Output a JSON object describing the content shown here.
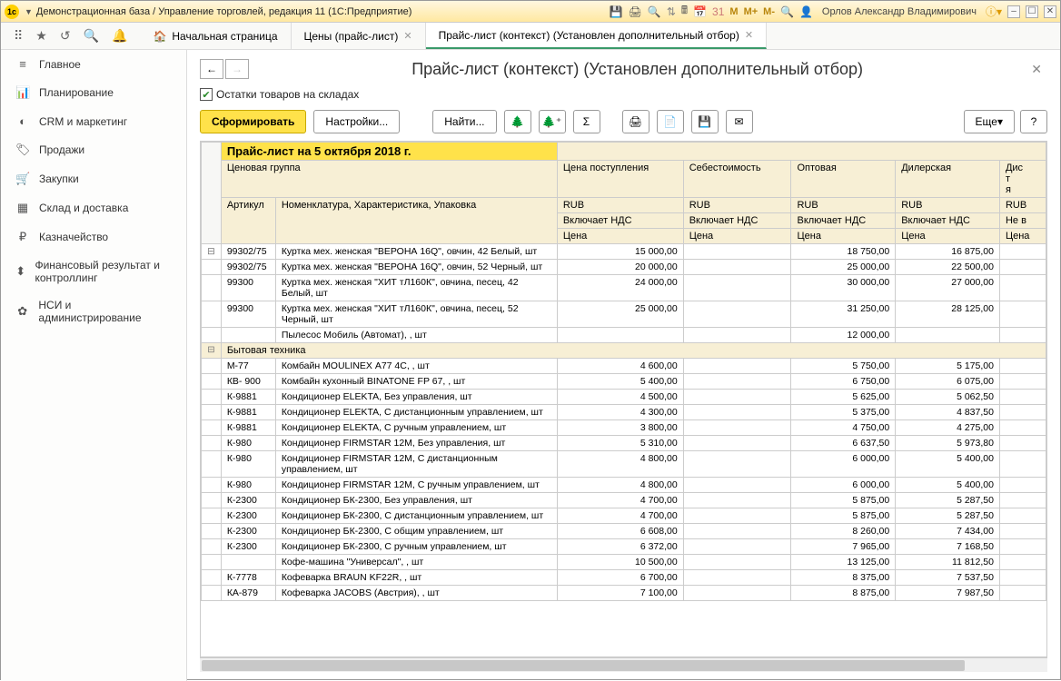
{
  "titlebar": {
    "title": "Демонстрационная база / Управление торговлей, редакция 11  (1С:Предприятие)",
    "user": "Орлов Александр Владимирович"
  },
  "navtabs": {
    "home": "Начальная страница",
    "prices": "Цены (прайс-лист)",
    "pricelist": "Прайс-лист (контекст) (Установлен дополнительный отбор)"
  },
  "sidebar": {
    "items": [
      {
        "icon": "≡",
        "label": "Главное"
      },
      {
        "icon": "📊",
        "label": "Планирование"
      },
      {
        "icon": "◐",
        "label": "CRM и маркетинг"
      },
      {
        "icon": "🏷",
        "label": "Продажи"
      },
      {
        "icon": "🛒",
        "label": "Закупки"
      },
      {
        "icon": "▦",
        "label": "Склад и доставка"
      },
      {
        "icon": "₽",
        "label": "Казначейство"
      },
      {
        "icon": "⬍",
        "label": "Финансовый результат и контроллинг"
      },
      {
        "icon": "✿",
        "label": "НСИ и администрирование"
      }
    ]
  },
  "page": {
    "title": "Прайс-лист (контекст) (Установлен дополнительный отбор)",
    "checkbox_label": "Остатки товаров на складах"
  },
  "toolbar": {
    "generate": "Сформировать",
    "settings": "Настройки...",
    "find": "Найти...",
    "more": "Еще"
  },
  "grid": {
    "report_title": "Прайс-лист на 5 октября 2018 г.",
    "hdr": {
      "price_group": "Ценовая группа",
      "article": "Артикул",
      "nomenclature": "Номенклатура, Характеристика, Упаковка",
      "price_in": "Цена поступления",
      "cost": "Себестоимость",
      "wholesale": "Оптовая",
      "dealer": "Дилерская",
      "dist": "Дис\nт\nя",
      "rub": "RUB",
      "vat_inc": "Включает НДС",
      "vat_none": "Не в",
      "price": "Цена",
      "price_cut": "Цена"
    },
    "group1": "Бытовая техника",
    "rows_top": [
      {
        "a": "99302/75",
        "n": "Куртка мех. женская \"ВЕРОНА 16Q\", овчин, 42 Белый, шт",
        "p1": "15 000,00",
        "p2": "",
        "p3": "18 750,00",
        "p4": "16 875,00"
      },
      {
        "a": "99302/75",
        "n": "Куртка мех. женская \"ВЕРОНА 16Q\", овчин, 52 Черный, шт",
        "p1": "20 000,00",
        "p2": "",
        "p3": "25 000,00",
        "p4": "22 500,00"
      },
      {
        "a": "99300",
        "n": "Куртка мех. женская \"ХИТ тЛ160К\", овчина, песец, 42 Белый, шт",
        "p1": "24 000,00",
        "p2": "",
        "p3": "30 000,00",
        "p4": "27 000,00"
      },
      {
        "a": "99300",
        "n": "Куртка мех. женская \"ХИТ тЛ160К\", овчина, песец, 52 Черный, шт",
        "p1": "25 000,00",
        "p2": "",
        "p3": "31 250,00",
        "p4": "28 125,00"
      },
      {
        "a": "",
        "n": "Пылесос Мобиль (Автомат), , шт",
        "p1": "",
        "p2": "",
        "p3": "12 000,00",
        "p4": ""
      }
    ],
    "rows_group": [
      {
        "a": "М-77",
        "n": "Комбайн MOULINEX  А77 4С, , шт",
        "p1": "4 600,00",
        "p3": "5 750,00",
        "p4": "5 175,00"
      },
      {
        "a": "КВ- 900",
        "n": "Комбайн кухонный BINATONE FP 67, , шт",
        "p1": "5 400,00",
        "p3": "6 750,00",
        "p4": "6 075,00"
      },
      {
        "a": "К-9881",
        "n": "Кондиционер ELEKTA, Без управления, шт",
        "p1": "4 500,00",
        "p3": "5 625,00",
        "p4": "5 062,50"
      },
      {
        "a": "К-9881",
        "n": "Кондиционер ELEKTA, С дистанционным управлением, шт",
        "p1": "4 300,00",
        "p3": "5 375,00",
        "p4": "4 837,50"
      },
      {
        "a": "К-9881",
        "n": "Кондиционер ELEKTA, С ручным управлением, шт",
        "p1": "3 800,00",
        "p3": "4 750,00",
        "p4": "4 275,00"
      },
      {
        "a": "К-980",
        "n": "Кондиционер FIRMSTAR 12M, Без управления, шт",
        "p1": "5 310,00",
        "p3": "6 637,50",
        "p4": "5 973,80"
      },
      {
        "a": "К-980",
        "n": "Кондиционер FIRMSTAR 12M, С дистанционным управлением, шт",
        "p1": "4 800,00",
        "p3": "6 000,00",
        "p4": "5 400,00"
      },
      {
        "a": "К-980",
        "n": "Кондиционер FIRMSTAR 12M, С ручным управлением, шт",
        "p1": "4 800,00",
        "p3": "6 000,00",
        "p4": "5 400,00"
      },
      {
        "a": "К-2300",
        "n": "Кондиционер БК-2300, Без управления, шт",
        "p1": "4 700,00",
        "p3": "5 875,00",
        "p4": "5 287,50"
      },
      {
        "a": "К-2300",
        "n": "Кондиционер БК-2300, С дистанционным управлением, шт",
        "p1": "4 700,00",
        "p3": "5 875,00",
        "p4": "5 287,50"
      },
      {
        "a": "К-2300",
        "n": "Кондиционер БК-2300, С общим управлением, шт",
        "p1": "6 608,00",
        "p3": "8 260,00",
        "p4": "7 434,00"
      },
      {
        "a": "К-2300",
        "n": "Кондиционер БК-2300, С ручным управлением, шт",
        "p1": "6 372,00",
        "p3": "7 965,00",
        "p4": "7 168,50"
      },
      {
        "a": "",
        "n": "Кофе-машина \"Универсал\", , шт",
        "p1": "10 500,00",
        "p3": "13 125,00",
        "p4": "11 812,50"
      },
      {
        "a": "К-7778",
        "n": "Кофеварка BRAUN KF22R, , шт",
        "p1": "6 700,00",
        "p3": "8 375,00",
        "p4": "7 537,50"
      },
      {
        "a": "КА-879",
        "n": "Кофеварка JACOBS (Австрия), , шт",
        "p1": "7 100,00",
        "p3": "8 875,00",
        "p4": "7 987,50"
      }
    ]
  }
}
